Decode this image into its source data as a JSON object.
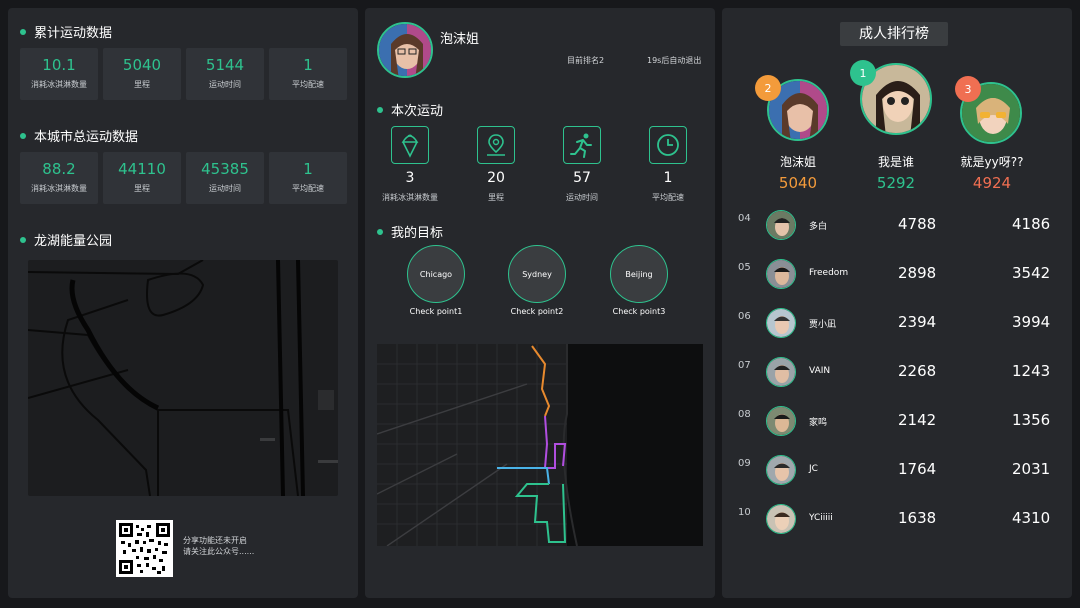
{
  "left": {
    "cumulative": {
      "title": "累计运动数据",
      "stats": [
        {
          "value": "10.1",
          "label": "消耗冰淇淋数量"
        },
        {
          "value": "5040",
          "label": "里程"
        },
        {
          "value": "5144",
          "label": "运动时间"
        },
        {
          "value": "1",
          "label": "平均配速"
        }
      ]
    },
    "city": {
      "title": "本城市总运动数据",
      "stats": [
        {
          "value": "88.2",
          "label": "消耗冰淇淋数量"
        },
        {
          "value": "44110",
          "label": "里程"
        },
        {
          "value": "45385",
          "label": "运动时间"
        },
        {
          "value": "1",
          "label": "平均配速"
        }
      ]
    },
    "park": {
      "title": "龙湖能量公园"
    },
    "share": {
      "line1": "分享功能还未开启",
      "line2": "请关注此公众号......"
    }
  },
  "mid": {
    "user": {
      "name": "泡沫姐",
      "rank": "目前排名2",
      "exit": "19s后自动退出"
    },
    "current": {
      "title": "本次运动",
      "items": [
        {
          "icon": "ice-cream-icon",
          "value": "3",
          "label": "消耗冰淇淋数量"
        },
        {
          "icon": "location-pin-icon",
          "value": "20",
          "label": "里程"
        },
        {
          "icon": "running-icon",
          "value": "57",
          "label": "运动时间"
        },
        {
          "icon": "clock-icon",
          "value": "1",
          "label": "平均配速"
        }
      ]
    },
    "goals": {
      "title": "我的目标",
      "items": [
        {
          "city": "Chicago",
          "label": "Check point1"
        },
        {
          "city": "Sydney",
          "label": "Check point2"
        },
        {
          "city": "Beijing",
          "label": "Check point3"
        }
      ]
    }
  },
  "right": {
    "title": "成人排行榜",
    "top3": [
      {
        "rank": "2",
        "name": "泡沫姐",
        "score": "5040",
        "color": "#f39b3b"
      },
      {
        "rank": "1",
        "name": "我是谁",
        "score": "5292",
        "color": "#2ec28e"
      },
      {
        "rank": "3",
        "name": "就是yy呀??",
        "score": "4924",
        "color": "#f06f52"
      }
    ],
    "list": [
      {
        "rank": "04",
        "name": "多白",
        "v1": "4788",
        "v2": "4186"
      },
      {
        "rank": "05",
        "name": "Freedom",
        "v1": "2898",
        "v2": "3542"
      },
      {
        "rank": "06",
        "name": "贾小凪",
        "v1": "2394",
        "v2": "3994"
      },
      {
        "rank": "07",
        "name": "VAIN",
        "v1": "2268",
        "v2": "1243"
      },
      {
        "rank": "08",
        "name": "家鸣",
        "v1": "2142",
        "v2": "1356"
      },
      {
        "rank": "09",
        "name": "JC",
        "v1": "1764",
        "v2": "2031"
      },
      {
        "rank": "10",
        "name": "YCiiiii",
        "v1": "1638",
        "v2": "4310"
      }
    ]
  },
  "colors": {
    "accent": "#2ec28e",
    "panel": "#26282c",
    "box": "#303338"
  }
}
